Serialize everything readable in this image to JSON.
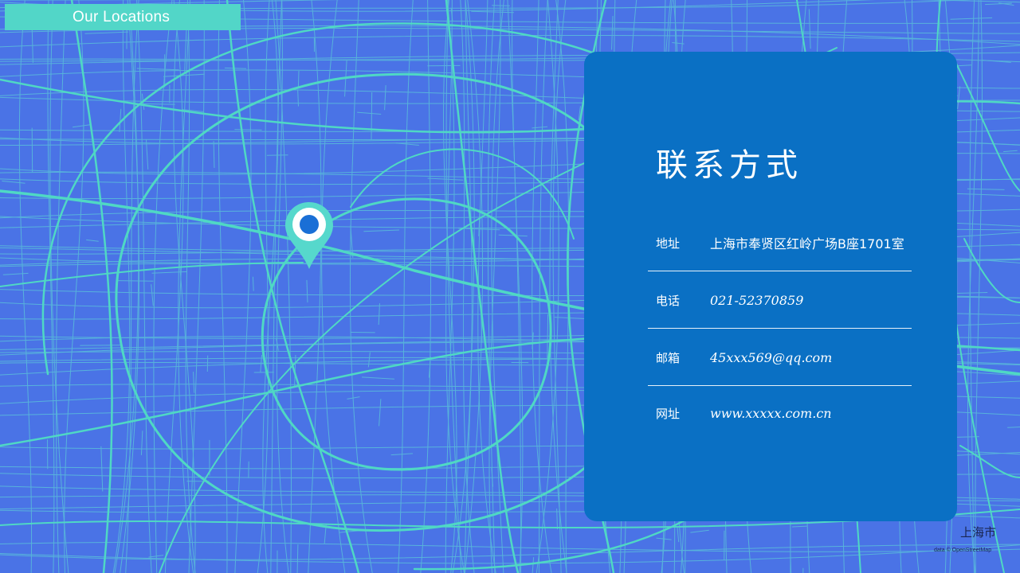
{
  "header": {
    "title": "Our Locations"
  },
  "contact": {
    "heading": "联系方式",
    "rows": [
      {
        "label": "地址",
        "value": "上海市奉贤区红岭广场B座1701室"
      },
      {
        "label": "电话",
        "value": "021-52370859"
      },
      {
        "label": "邮箱",
        "value": "45xxx569@qq.com"
      },
      {
        "label": "网址",
        "value": "www.xxxxx.com.cn"
      }
    ]
  },
  "map": {
    "city_label": "上海市",
    "attribution": "data © OpenStreetMap",
    "colors": {
      "background": "#4a73e6",
      "roads": "#4fd8c4",
      "card": "#0a70c4",
      "pin": "#56d8cc",
      "pin_dot": "#1a6fd6"
    },
    "marker_icon": "map-pin-icon"
  }
}
